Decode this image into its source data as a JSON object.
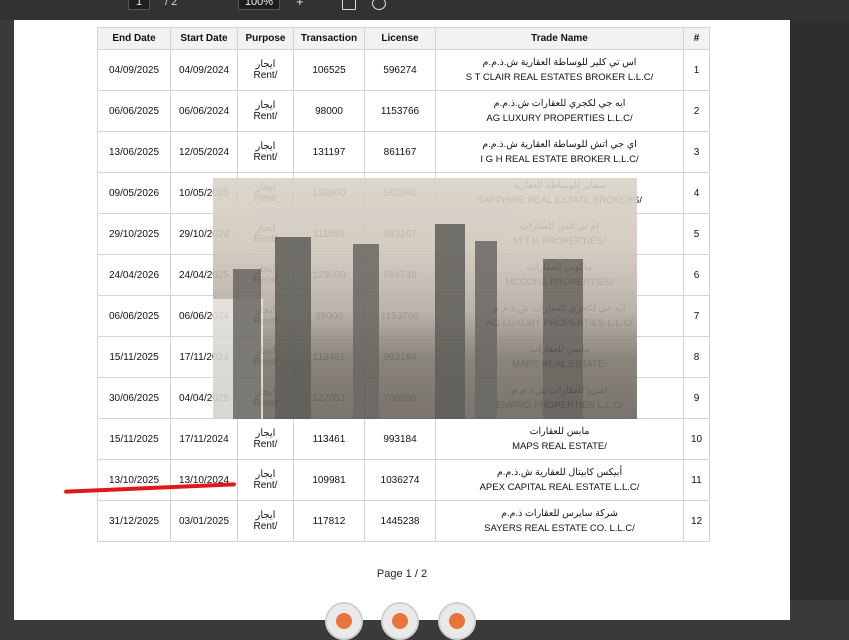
{
  "toolbar": {
    "page_current": "1",
    "page_total": "/ 2",
    "zoom": "100%",
    "zoom_in": "+"
  },
  "table": {
    "headers": {
      "end": "End Date",
      "start": "Start Date",
      "purpose": "Purpose",
      "transaction": "Transaction",
      "license": "License",
      "trade": "Trade Name",
      "num": "#"
    },
    "rows": [
      {
        "end": "04/09/2025",
        "start": "04/09/2024",
        "purpose_ar": "ايجار",
        "purpose_en": "Rent/",
        "transaction": "106525",
        "license": "596274",
        "name_ar": "اس تي كلير للوساطة العقارية ش.ذ.م.م",
        "name_en": "S T CLAIR REAL ESTATES BROKER L.L.C/",
        "num": "1"
      },
      {
        "end": "06/06/2025",
        "start": "06/06/2024",
        "purpose_ar": "ايجار",
        "purpose_en": "Rent/",
        "transaction": "98000",
        "license": "1153766",
        "name_ar": "ايه جي لكجري للعقارات ش.ذ.م.م",
        "name_en": "AG LUXURY PROPERTIES L.L.C/",
        "num": "2"
      },
      {
        "end": "13/06/2025",
        "start": "12/05/2024",
        "purpose_ar": "ايجار",
        "purpose_en": "Rent/",
        "transaction": "131197",
        "license": "861167",
        "name_ar": "اي جي اتش للوساطة العقارية ش.ذ.م.م",
        "name_en": "I G H REAL ESTATE BROKER L.L.C/",
        "num": "3"
      },
      {
        "end": "09/05/2026",
        "start": "10/05/2025",
        "purpose_ar": "ايجار",
        "purpose_en": "Rent/",
        "transaction": "130960",
        "license": "562560",
        "name_ar": "سفاير للوساطة العقارية",
        "name_en": "SAPPHIRE REAL ESTATE BROKERS/",
        "num": "4"
      },
      {
        "end": "29/10/2025",
        "start": "29/10/2024",
        "purpose_ar": "ايجار",
        "purpose_en": "Rent/",
        "transaction": "111559",
        "license": "983167",
        "name_ar": "ام تي اتش للعقارات",
        "name_en": "M T H PROPERTIES/",
        "num": "5"
      },
      {
        "end": "24/04/2026",
        "start": "24/04/2025",
        "purpose_ar": "ايجار",
        "purpose_en": "Rent/",
        "transaction": "129080",
        "license": "684748",
        "name_ar": "ماكوني للعقارات",
        "name_en": "MCCONE PROPERTIES/",
        "num": "6"
      },
      {
        "end": "06/06/2025",
        "start": "06/06/2024",
        "purpose_ar": "ايجار",
        "purpose_en": "Rent/",
        "transaction": "98000",
        "license": "1153766",
        "name_ar": "ايه جي لكجري للعقارات ش.ذ.م.م",
        "name_en": "AG LUXURY PROPERTIES L.L.C/",
        "num": "7"
      },
      {
        "end": "15/11/2025",
        "start": "17/11/2024",
        "purpose_ar": "ايجار",
        "purpose_en": "Rent/",
        "transaction": "113461",
        "license": "993184",
        "name_ar": "مابس للعقارات",
        "name_en": "MAPS REAL ESTATE/",
        "num": "8"
      },
      {
        "end": "30/06/2025",
        "start": "04/04/2025",
        "purpose_ar": "ايجار",
        "purpose_en": "Rent/",
        "transaction": "127051",
        "license": "706956",
        "name_ar": "امبرو للعقارات ش.ذ.م.م",
        "name_en": "EMPRO PROPERTIES L.L.C/",
        "num": "9"
      },
      {
        "end": "15/11/2025",
        "start": "17/11/2024",
        "purpose_ar": "ايجار",
        "purpose_en": "Rent/",
        "transaction": "113461",
        "license": "993184",
        "name_ar": "مابس للعقارات",
        "name_en": "MAPS REAL ESTATE/",
        "num": "10"
      },
      {
        "end": "13/10/2025",
        "start": "13/10/2024",
        "purpose_ar": "ايجار",
        "purpose_en": "Rent/",
        "transaction": "109981",
        "license": "1036274",
        "name_ar": "أبيكس كابيتال للعقارية ش.ذ.م.م",
        "name_en": "APEX CAPITAL REAL ESTATE L.L.C/",
        "num": "11"
      },
      {
        "end": "31/12/2025",
        "start": "03/01/2025",
        "purpose_ar": "ايجار",
        "purpose_en": "Rent/",
        "transaction": "117812",
        "license": "1445238",
        "name_ar": "شركة سايرس للعقارات ذ.م.م",
        "name_en": "SAYERS REAL ESTATE CO. L.L.C/",
        "num": "12"
      }
    ]
  },
  "footer": {
    "page_label": "Page 1 / 2"
  },
  "colors": {
    "highlight_line": "#e01818",
    "stamp_accent": "#e8743b"
  }
}
